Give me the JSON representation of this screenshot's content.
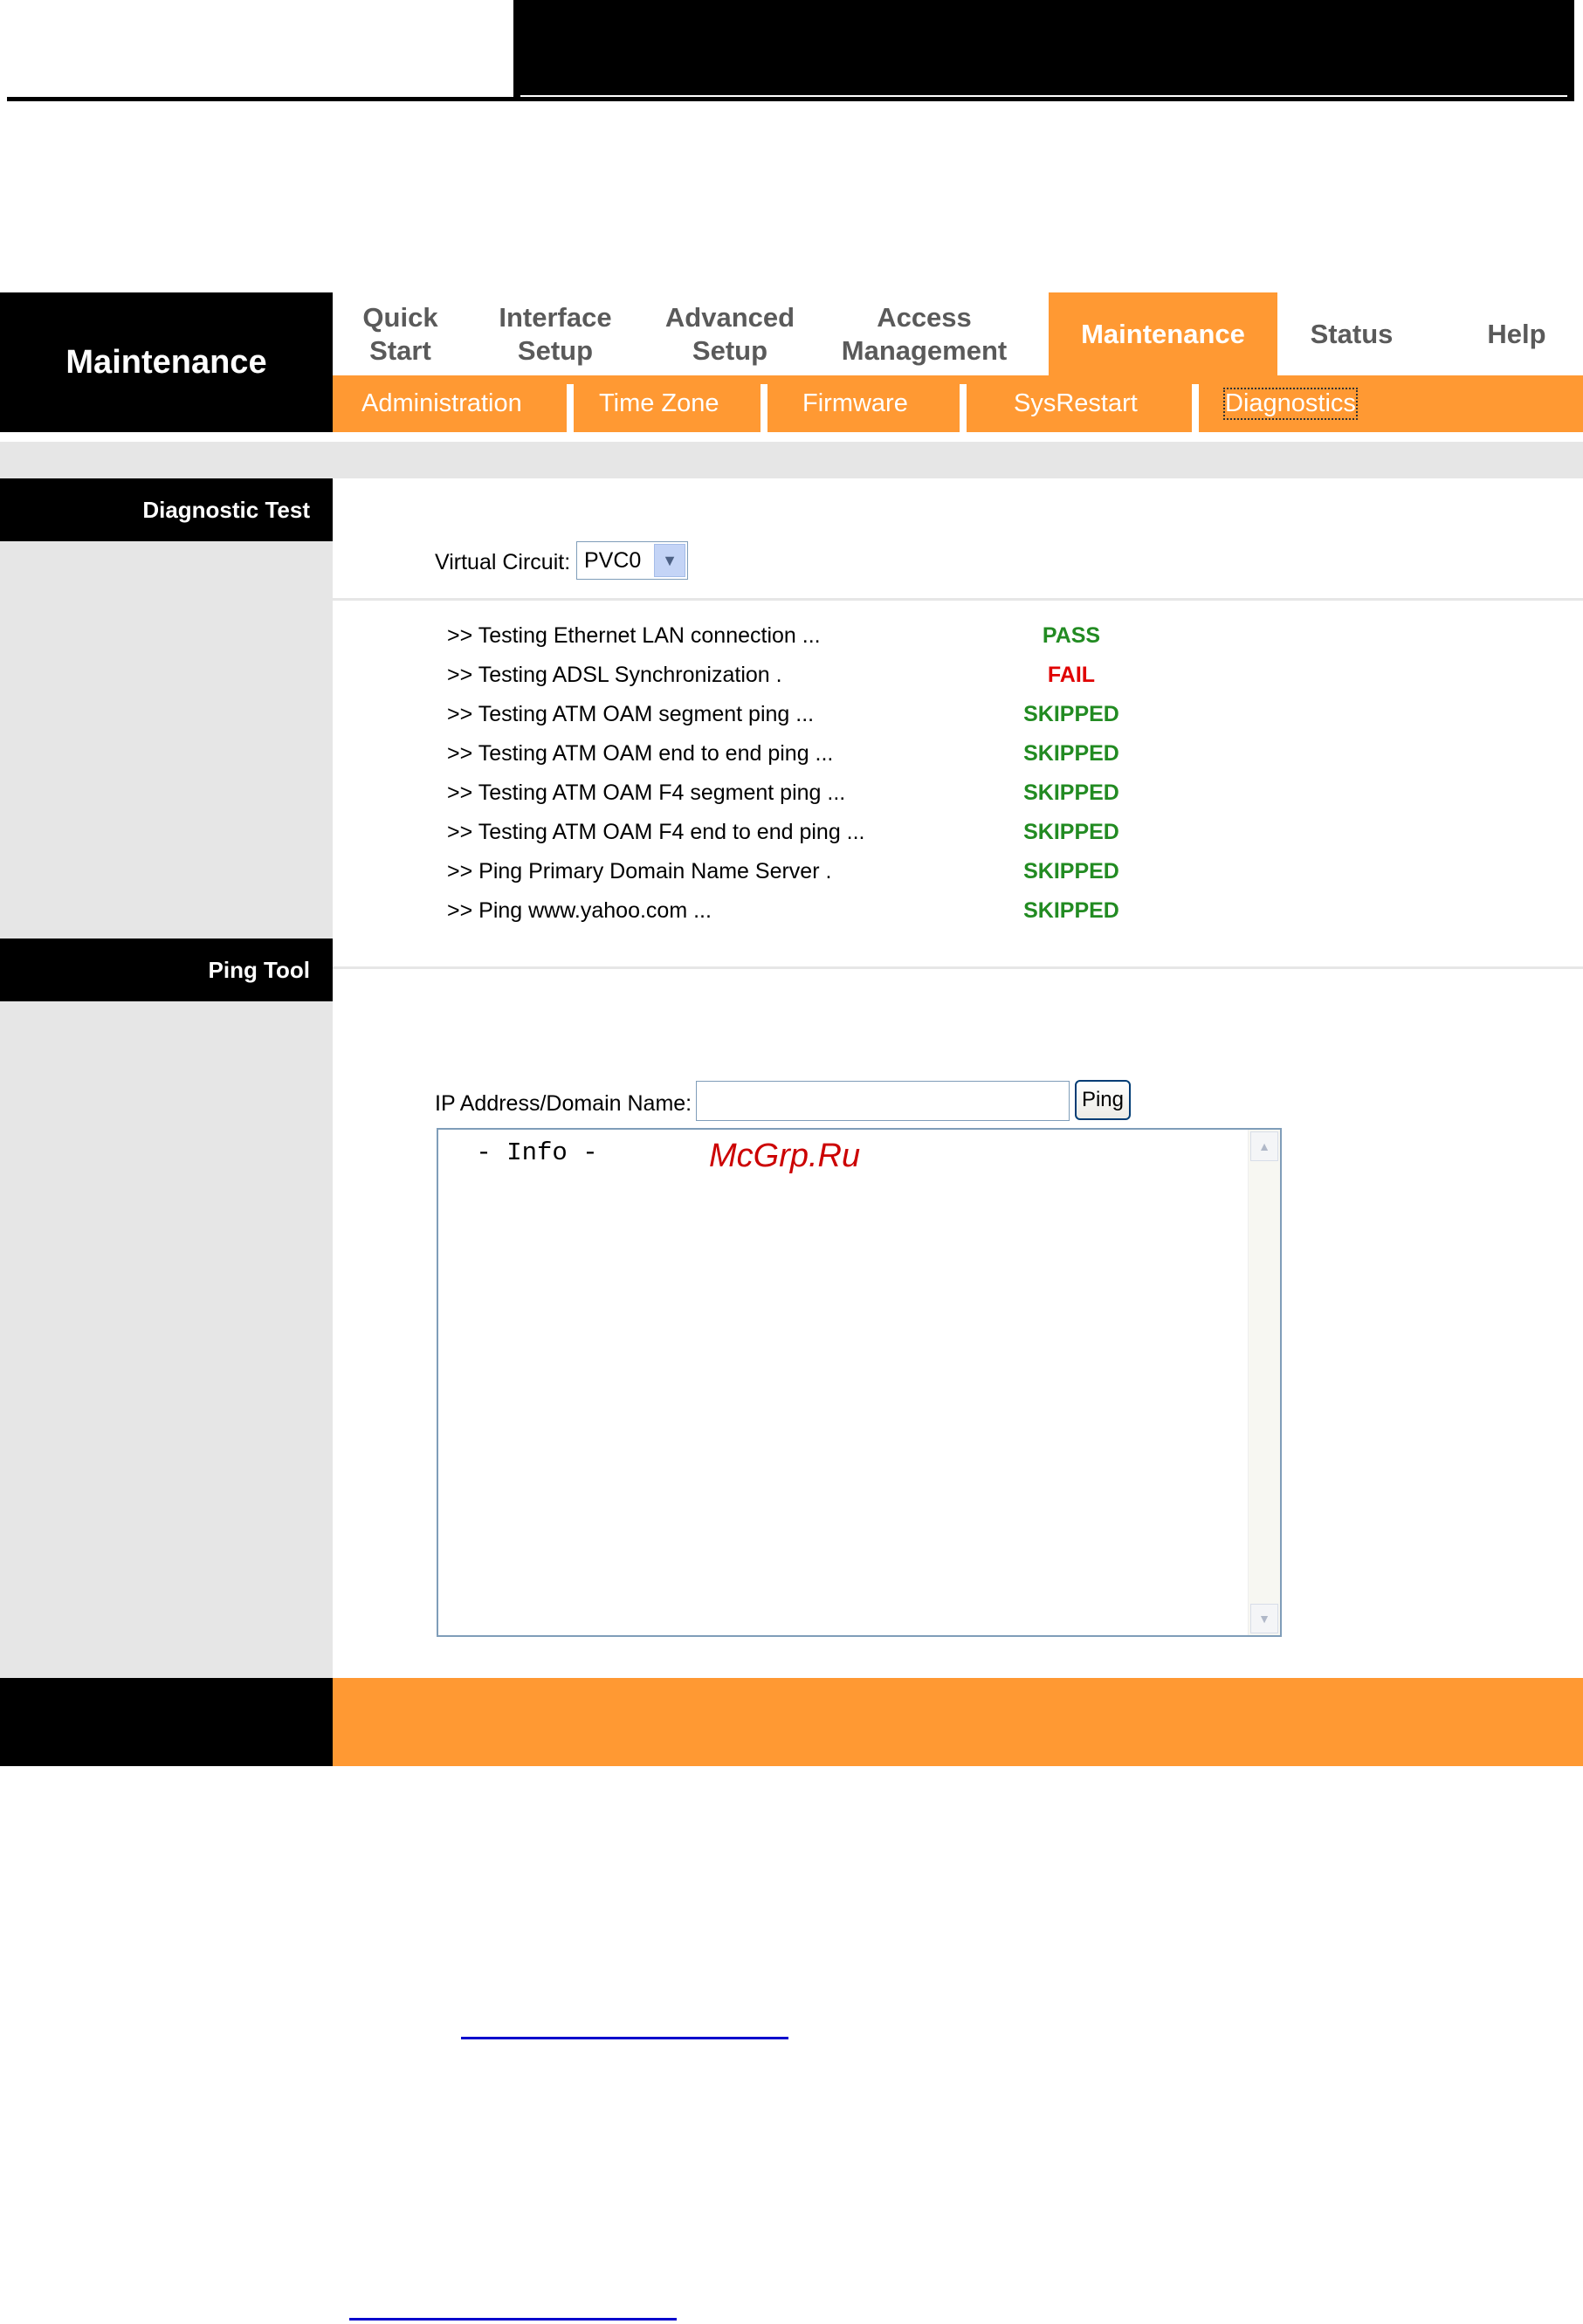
{
  "app": {
    "title": "Maintenance"
  },
  "nav": {
    "items": [
      {
        "label": "Quick\nStart"
      },
      {
        "label": "Interface\nSetup"
      },
      {
        "label": "Advanced\nSetup"
      },
      {
        "label": "Access\nManagement"
      },
      {
        "label": "Maintenance"
      },
      {
        "label": "Status"
      },
      {
        "label": "Help"
      }
    ],
    "active": "Maintenance"
  },
  "subnav": {
    "items": [
      {
        "label": "Administration"
      },
      {
        "label": "Time Zone"
      },
      {
        "label": "Firmware"
      },
      {
        "label": "SysRestart"
      },
      {
        "label": "Diagnostics"
      }
    ],
    "active": "Diagnostics"
  },
  "sections": {
    "diagnostic_test": "Diagnostic Test",
    "ping_tool": "Ping Tool"
  },
  "virtual_circuit": {
    "label": "Virtual Circuit:",
    "value": "PVC0"
  },
  "diagnostics": [
    {
      "test": ">> Testing Ethernet LAN connection ...",
      "result": "PASS"
    },
    {
      "test": ">> Testing ADSL Synchronization .",
      "result": "FAIL"
    },
    {
      "test": ">> Testing ATM OAM segment ping ...",
      "result": "SKIPPED"
    },
    {
      "test": ">> Testing ATM OAM end to end ping ...",
      "result": "SKIPPED"
    },
    {
      "test": ">> Testing ATM OAM F4 segment ping ...",
      "result": "SKIPPED"
    },
    {
      "test": ">> Testing ATM OAM F4 end to end ping ...",
      "result": "SKIPPED"
    },
    {
      "test": ">> Ping Primary Domain Name Server .",
      "result": "SKIPPED"
    },
    {
      "test": ">> Ping www.yahoo.com ...",
      "result": "SKIPPED"
    }
  ],
  "ping": {
    "label": "IP Address/Domain Name:",
    "value": "",
    "button": "Ping",
    "info": " - Info -"
  },
  "watermark": "McGrp.Ru",
  "colors": {
    "accent": "#ff9933",
    "pass": "#228b22",
    "fail": "#e00000"
  }
}
